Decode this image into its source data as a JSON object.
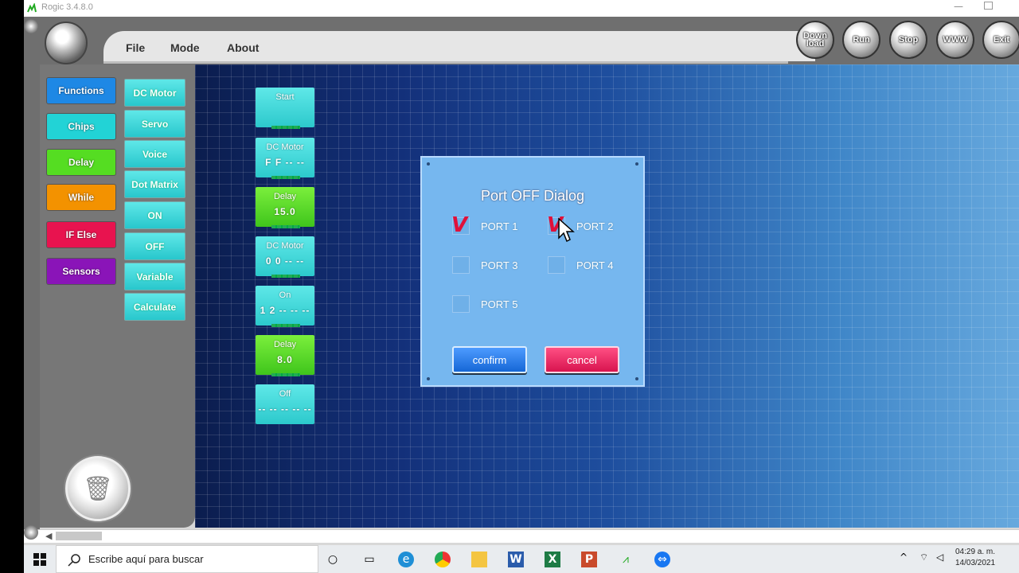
{
  "window": {
    "title": "Rogic 3.4.8.0",
    "minimize": "—"
  },
  "menu": {
    "items": [
      "File",
      "Mode",
      "About"
    ]
  },
  "toolbar_buttons": [
    "Down load",
    "Run",
    "Stop",
    "WWW",
    "Exit"
  ],
  "categories": [
    {
      "label": "Functions",
      "color": "#1e88e5"
    },
    {
      "label": "Chips",
      "color": "#22d3d6"
    },
    {
      "label": "Delay",
      "color": "#55dd22"
    },
    {
      "label": "While",
      "color": "#f39200"
    },
    {
      "label": "IF Else",
      "color": "#e8134f"
    },
    {
      "label": "Sensors",
      "color": "#8a14b8"
    }
  ],
  "subitems": [
    "DC Motor",
    "Servo",
    "Voice",
    "Dot Matrix",
    "ON",
    "OFF",
    "Variable",
    "Calculate"
  ],
  "program_blocks": [
    {
      "title": "Start",
      "value": "",
      "color": "cyan"
    },
    {
      "title": "DC Motor",
      "value": "F F -- --",
      "color": "cyan"
    },
    {
      "title": "Delay",
      "value": "15.0",
      "color": "green"
    },
    {
      "title": "DC Motor",
      "value": "0 0 -- --",
      "color": "cyan"
    },
    {
      "title": "On",
      "value": "1 2 -- -- --",
      "color": "cyan"
    },
    {
      "title": "Delay",
      "value": "8.0",
      "color": "green"
    },
    {
      "title": "Off",
      "value": "-- -- -- -- --",
      "color": "cyan"
    }
  ],
  "dialog": {
    "title": "Port OFF Dialog",
    "ports": [
      {
        "label": "PORT 1",
        "checked": true
      },
      {
        "label": "PORT 2",
        "checked": true
      },
      {
        "label": "PORT 3",
        "checked": false
      },
      {
        "label": "PORT 4",
        "checked": false
      },
      {
        "label": "PORT 5",
        "checked": false
      }
    ],
    "confirm_label": "confirm",
    "cancel_label": "cancel",
    "check_mark": "V"
  },
  "taskbar": {
    "search_placeholder": "Escribe aquí para buscar",
    "time": "04:29 a. m.",
    "date": "14/03/2021"
  }
}
